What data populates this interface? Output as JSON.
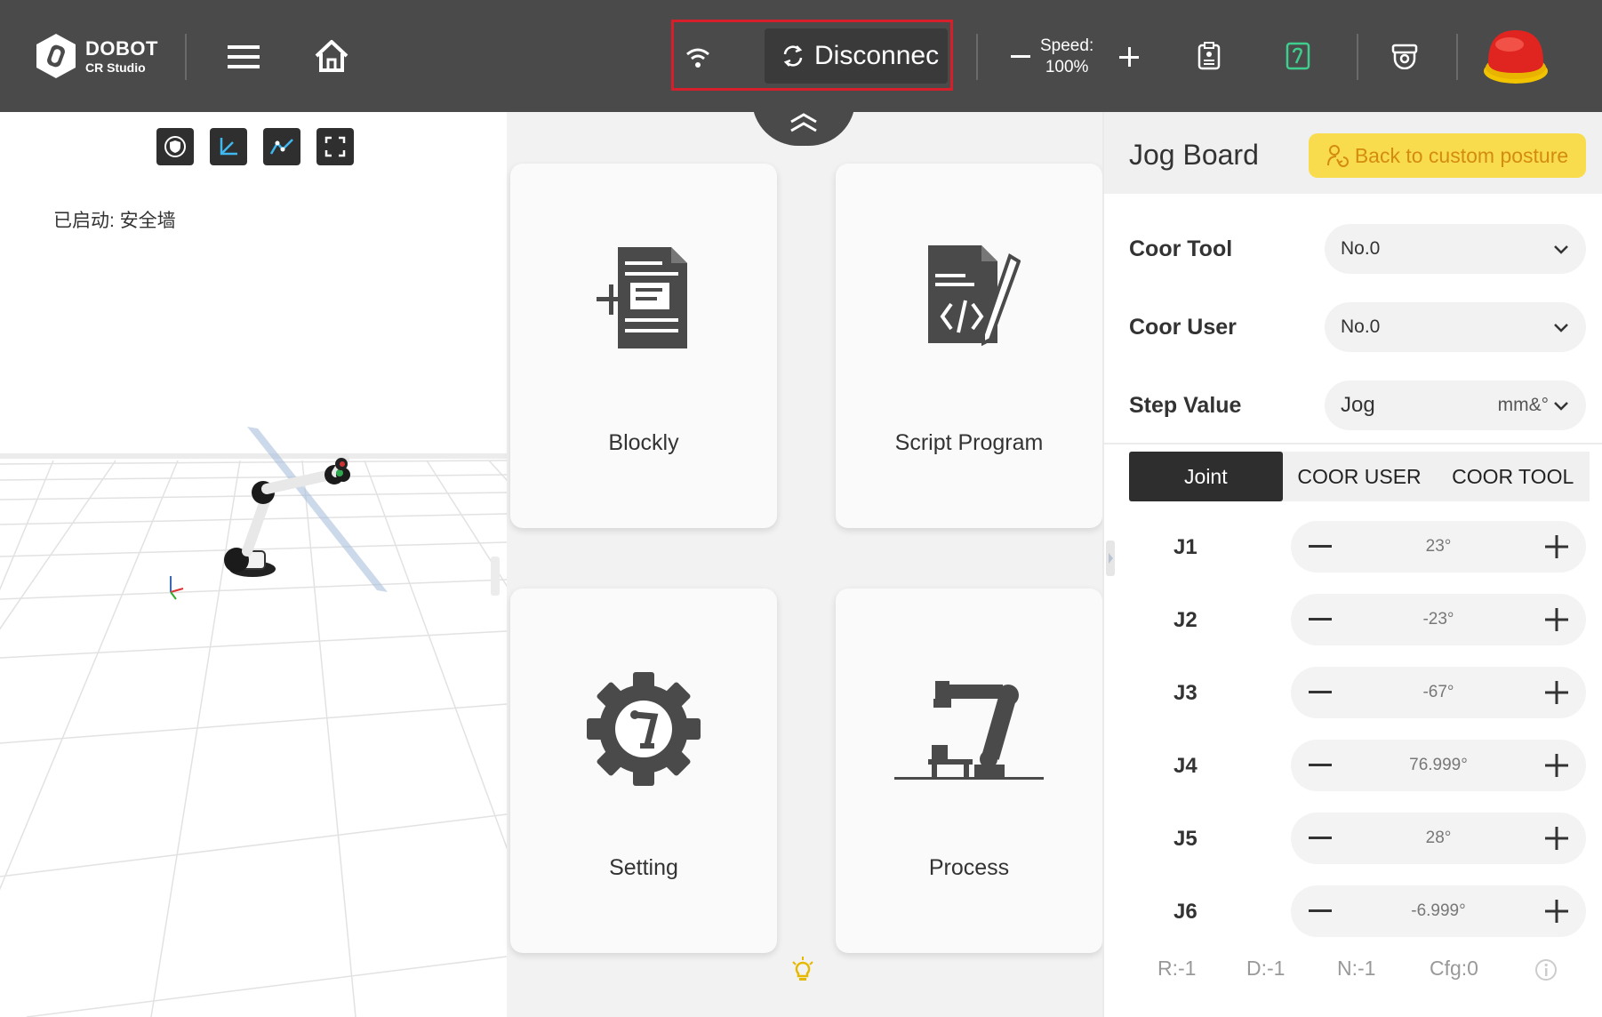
{
  "app": {
    "logo_text": "DOBOT",
    "logo_subtext": "CR Studio"
  },
  "topbar": {
    "disconnect_label": "Disconnec",
    "speed_label": "Speed:",
    "speed_value": "100%"
  },
  "viewport": {
    "status_text": "已启动: 安全墙"
  },
  "cards": {
    "blockly": "Blockly",
    "script": "Script Program",
    "setting": "Setting",
    "process": "Process"
  },
  "jog": {
    "title": "Jog Board",
    "back_button": "Back to custom posture",
    "coor_tool_label": "Coor Tool",
    "coor_tool_value": "No.0",
    "coor_user_label": "Coor User",
    "coor_user_value": "No.0",
    "step_label": "Step Value",
    "step_value": "Jog",
    "step_unit": "mm&°",
    "tabs": [
      "Joint",
      "COOR USER",
      "COOR TOOL"
    ],
    "joints": [
      {
        "name": "J1",
        "value": "23°"
      },
      {
        "name": "J2",
        "value": "-23°"
      },
      {
        "name": "J3",
        "value": "-67°"
      },
      {
        "name": "J4",
        "value": "76.999°"
      },
      {
        "name": "J5",
        "value": "28°"
      },
      {
        "name": "J6",
        "value": "-6.999°"
      }
    ],
    "footer": {
      "r": "R:-1",
      "d": "D:-1",
      "n": "N:-1",
      "cfg": "Cfg:0"
    }
  },
  "colors": {
    "topbar": "#4a4a4a",
    "highlight": "#d61f2a",
    "accent_yellow": "#f9dc4d",
    "estop": "#e0241f"
  }
}
